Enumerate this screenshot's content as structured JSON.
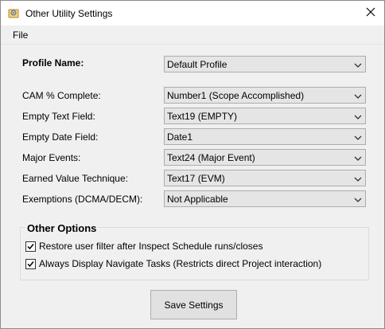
{
  "window": {
    "title": "Other Utility Settings",
    "app_icon": "settings-app-icon",
    "close_icon": "close-icon"
  },
  "menu": {
    "file": "File"
  },
  "profile": {
    "label": "Profile Name:",
    "value": "Default Profile"
  },
  "fields": [
    {
      "label": "CAM % Complete:",
      "value": "Number1 (Scope Accomplished)"
    },
    {
      "label": "Empty Text Field:",
      "value": "Text19 (EMPTY)"
    },
    {
      "label": "Empty Date Field:",
      "value": "Date1"
    },
    {
      "label": "Major Events:",
      "value": "Text24 (Major Event)"
    },
    {
      "label": "Earned Value Technique:",
      "value": "Text17 (EVM)"
    },
    {
      "label": "Exemptions (DCMA/DECM):",
      "value": "Not Applicable"
    }
  ],
  "options": {
    "title": "Other Options",
    "items": [
      {
        "label": "Restore user filter after Inspect Schedule runs/closes",
        "checked": true
      },
      {
        "label": "Always Display Navigate Tasks (Restricts direct Project interaction)",
        "checked": true
      }
    ]
  },
  "buttons": {
    "save": "Save Settings"
  }
}
